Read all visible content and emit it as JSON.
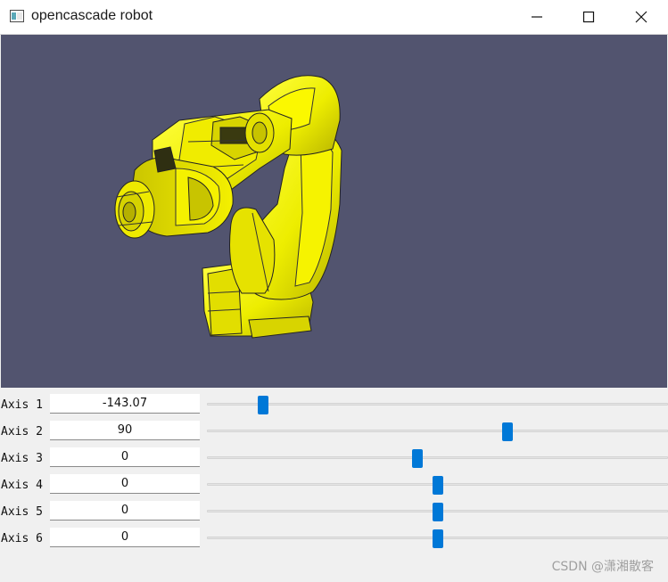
{
  "window": {
    "title": "opencascade robot",
    "minimize_icon": "minimize-icon",
    "maximize_icon": "maximize-icon",
    "close_icon": "close-icon"
  },
  "viewport": {
    "background": "#52546f",
    "model_color": "#f1f000",
    "object": "robot-arm-model"
  },
  "axes": [
    {
      "label": "Axis 1",
      "value": "-143.07",
      "slider_position": 0.122
    },
    {
      "label": "Axis 2",
      "value": "90",
      "slider_position": 0.652
    },
    {
      "label": "Axis 3",
      "value": "0",
      "slider_position": 0.457
    },
    {
      "label": "Axis 4",
      "value": "0",
      "slider_position": 0.5
    },
    {
      "label": "Axis 5",
      "value": "0",
      "slider_position": 0.5
    },
    {
      "label": "Axis 6",
      "value": "0",
      "slider_position": 0.5
    }
  ],
  "slider_color": "#0078d7",
  "watermark": "CSDN @潇湘散客"
}
